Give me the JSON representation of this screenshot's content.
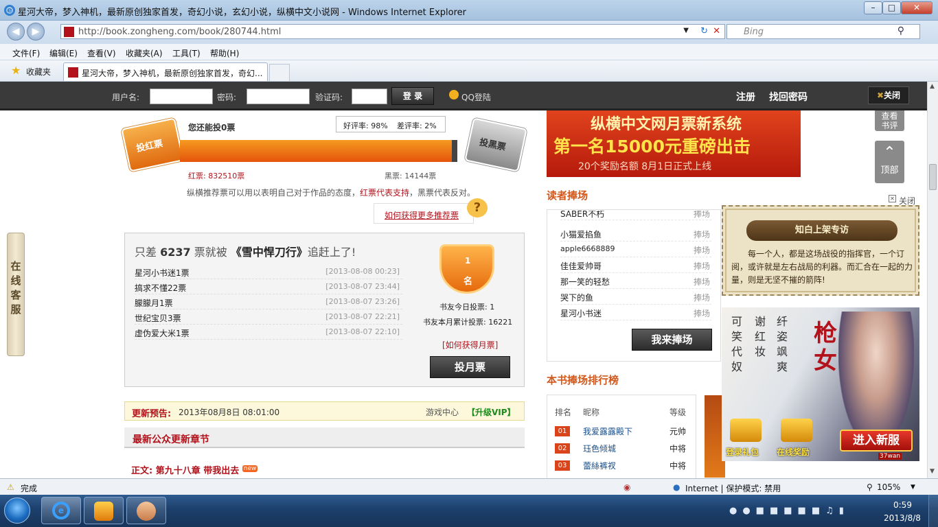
{
  "window": {
    "title": "星河大帝，梦入神机，最新原创独家首发，奇幻小说，玄幻小说，纵横中文小说网 - Windows Internet Explorer"
  },
  "address": {
    "url": "http://book.zongheng.com/book/280744.html",
    "search_placeholder": "Bing"
  },
  "menu": [
    "文件(F)",
    "编辑(E)",
    "查看(V)",
    "收藏夹(A)",
    "工具(T)",
    "帮助(H)"
  ],
  "tabs": {
    "favorites": "收藏夹",
    "active": "星河大帝，梦入神机，最新原创独家首发，奇幻..."
  },
  "login": {
    "user_label": "用户名:",
    "pass_label": "密码:",
    "captcha_label": "验证码:",
    "login_btn": "登 录",
    "qq": "QQ登陆",
    "register": "注册",
    "recover": "找回密码",
    "close": "关闭"
  },
  "vote": {
    "remaining": "您还能投0票",
    "positive_rate": "好评率: 98%",
    "negative_rate": "差评率: 2%",
    "red_label": "投红票",
    "black_label": "投黑票",
    "red_count": "红票: 832510票",
    "black_count": "黑票: 14144票",
    "red_fill": 0.98,
    "explain_a": "纵横推荐票可以用以表明自己对于作品的态度，",
    "explain_b": "红票代表支持",
    "explain_c": "，黑票代表反对。",
    "more": "如何获得更多推荐票"
  },
  "monthly": {
    "headline_a": "只差",
    "gap": "6237",
    "headline_b": "票就被",
    "target": "《雪中悍刀行》",
    "headline_c": "追赶上了!",
    "rows": [
      {
        "name": "星河小书迷1票",
        "date": "[2013-08-08 00:23]"
      },
      {
        "name": "搞求不懂22票",
        "date": "[2013-08-07 23:44]"
      },
      {
        "name": "朦朦月1票",
        "date": "[2013-08-07 23:26]"
      },
      {
        "name": "世纪宝贝3票",
        "date": "[2013-08-07 22:21]"
      },
      {
        "name": "虚伪爱大米1票",
        "date": "[2013-08-07 22:10]"
      }
    ],
    "rank_num": "1",
    "rank_unit": "名",
    "today": "书友今日投票: 1",
    "month_total": "书友本月累计投票: 16221",
    "how": "[如何获得月票]",
    "btn": "投月票"
  },
  "update": {
    "label": "更新预告:",
    "time": "2013年08月8日 08:01:00",
    "game": "游戏中心",
    "vip": "【升级VIP】"
  },
  "chapters": {
    "title": "最新公众更新章节",
    "first_prefix": "正文:",
    "first": "第九十八章 带我出去",
    "new_badge": "new"
  },
  "banner": {
    "line1": "纵横中文网月票新系统",
    "line2": "第一名15000元重磅出击",
    "line3": "20个奖励名额 8月1日正式上线"
  },
  "fans": {
    "title": "读者捧场",
    "rows": [
      {
        "name": "SABER不朽",
        "action": "捧场"
      },
      {
        "name": "小猫爱掐鱼",
        "action": "捧场"
      },
      {
        "name": "apple6668889",
        "action": "捧场"
      },
      {
        "name": "佳佳爱帅哥",
        "action": "捧场"
      },
      {
        "name": "那一笑的轻愁",
        "action": "捧场"
      },
      {
        "name": "哭下的鱼",
        "action": "捧场"
      },
      {
        "name": "星河小书迷",
        "action": "捧场"
      }
    ],
    "btn": "我来捧场"
  },
  "ranking": {
    "title": "本书捧场排行榜",
    "headers": [
      "排名",
      "昵称",
      "等级"
    ],
    "rows": [
      {
        "num": "01",
        "name": "我爱露露殿下",
        "level": "元帅"
      },
      {
        "num": "02",
        "name": "珏色倾城",
        "level": "中将"
      },
      {
        "num": "03",
        "name": "蕾絲裤衩",
        "level": "中将"
      }
    ]
  },
  "float_side": {
    "view": "查看书评",
    "top": "顶部",
    "close": "关闭"
  },
  "popup": {
    "title": "知白上架专访",
    "text": "每一个人，都是这场战役的指挥官，一个订阅，或许就是左右战局的利器。而汇合在一起的力量，则是无坚不摧的箭阵!"
  },
  "ad": {
    "poem": [
      "可笑代奴",
      "谢红妆",
      "纤姿飒爽"
    ],
    "name": "枪女",
    "gift": "登录礼包",
    "online": "在线奖励",
    "enter": "进入新服",
    "brand": "37wan"
  },
  "service": "在线客服",
  "status": {
    "done": "完成",
    "zone": "Internet | 保护模式: 禁用",
    "zoom": "105%"
  },
  "clock": {
    "time": "0:59",
    "date": "2013/8/8"
  }
}
